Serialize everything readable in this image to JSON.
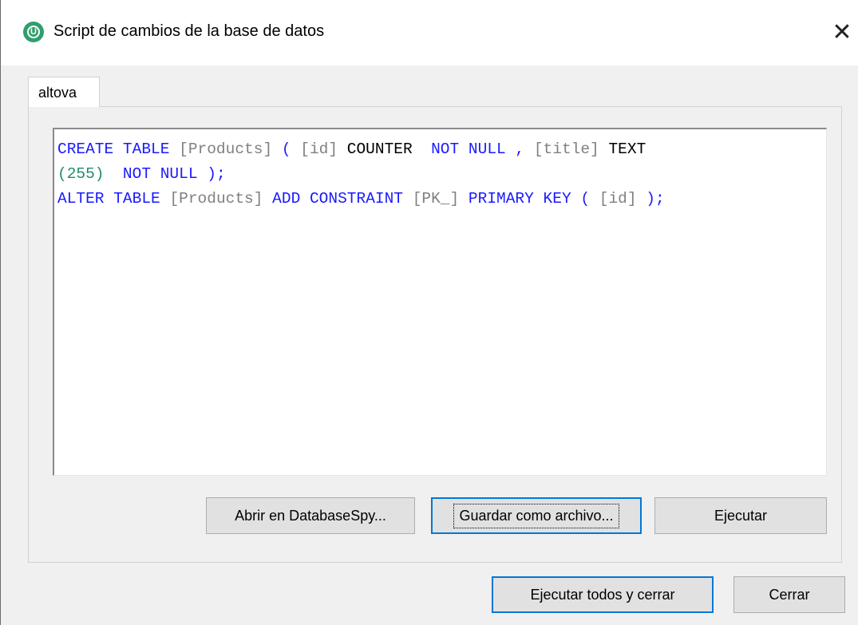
{
  "window": {
    "title": "Script de cambios de la base de datos",
    "close_symbol": "✕",
    "app_icon_glyph": "U"
  },
  "tabs": [
    {
      "label": "altova",
      "active": true
    }
  ],
  "editor": {
    "lines": [
      [
        {
          "t": "CREATE TABLE ",
          "c": "kw"
        },
        {
          "t": "[Products]",
          "c": "id"
        },
        {
          "t": " ( ",
          "c": "kw"
        },
        {
          "t": "[id]",
          "c": "id"
        },
        {
          "t": " COUNTER ",
          "c": "ty"
        },
        {
          "t": " NOT NULL , ",
          "c": "kw"
        },
        {
          "t": "[title]",
          "c": "id"
        },
        {
          "t": " TEXT",
          "c": "ty"
        }
      ],
      [
        {
          "t": "(255)",
          "c": "num"
        },
        {
          "t": "  NOT NULL );",
          "c": "kw"
        }
      ],
      [
        {
          "t": "ALTER TABLE ",
          "c": "kw"
        },
        {
          "t": "[Products]",
          "c": "id"
        },
        {
          "t": " ADD CONSTRAINT ",
          "c": "kw"
        },
        {
          "t": "[PK_]",
          "c": "id"
        },
        {
          "t": " PRIMARY KEY ( ",
          "c": "kw"
        },
        {
          "t": "[id]",
          "c": "id"
        },
        {
          "t": " );",
          "c": "kw"
        }
      ]
    ]
  },
  "panel_buttons": {
    "open_databasespy": "Abrir en DatabaseSpy...",
    "save_as_file": "Guardar como archivo...",
    "execute": "Ejecutar"
  },
  "footer_buttons": {
    "execute_all_close": "Ejecutar todos y cerrar",
    "close": "Cerrar"
  },
  "colors": {
    "keyword": "#1a1aff",
    "identifier": "#808080",
    "type": "#000000",
    "number": "#1f8a6f",
    "default_button_border": "#0078d7",
    "app_icon": "#2f9e6d"
  }
}
